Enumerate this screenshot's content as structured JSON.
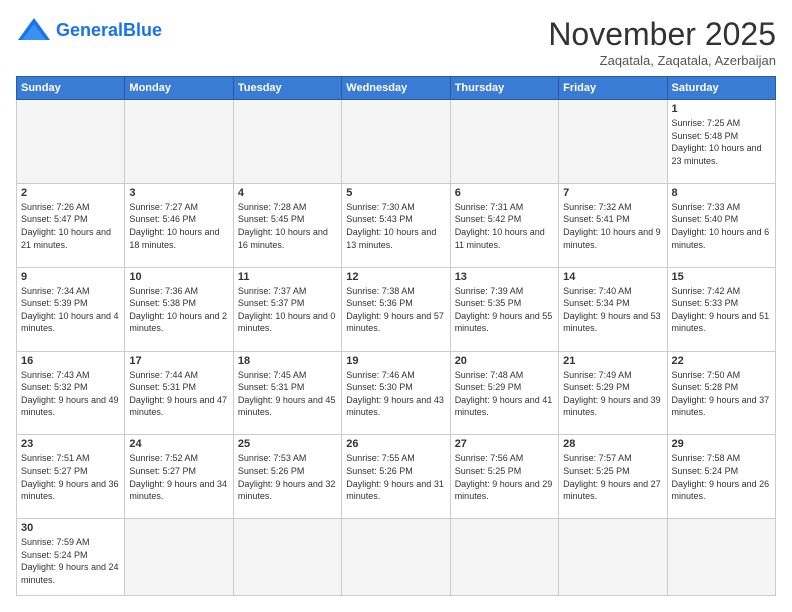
{
  "header": {
    "logo_general": "General",
    "logo_blue": "Blue",
    "month_title": "November 2025",
    "location": "Zaqatala, Zaqatala, Azerbaijan"
  },
  "weekdays": [
    "Sunday",
    "Monday",
    "Tuesday",
    "Wednesday",
    "Thursday",
    "Friday",
    "Saturday"
  ],
  "days": [
    {
      "num": "",
      "sunrise": "",
      "sunset": "",
      "daylight": "",
      "empty": true
    },
    {
      "num": "",
      "sunrise": "",
      "sunset": "",
      "daylight": "",
      "empty": true
    },
    {
      "num": "",
      "sunrise": "",
      "sunset": "",
      "daylight": "",
      "empty": true
    },
    {
      "num": "",
      "sunrise": "",
      "sunset": "",
      "daylight": "",
      "empty": true
    },
    {
      "num": "",
      "sunrise": "",
      "sunset": "",
      "daylight": "",
      "empty": true
    },
    {
      "num": "",
      "sunrise": "",
      "sunset": "",
      "daylight": "",
      "empty": true
    },
    {
      "num": "1",
      "sunrise": "Sunrise: 7:25 AM",
      "sunset": "Sunset: 5:48 PM",
      "daylight": "Daylight: 10 hours and 23 minutes."
    },
    {
      "num": "2",
      "sunrise": "Sunrise: 7:26 AM",
      "sunset": "Sunset: 5:47 PM",
      "daylight": "Daylight: 10 hours and 21 minutes."
    },
    {
      "num": "3",
      "sunrise": "Sunrise: 7:27 AM",
      "sunset": "Sunset: 5:46 PM",
      "daylight": "Daylight: 10 hours and 18 minutes."
    },
    {
      "num": "4",
      "sunrise": "Sunrise: 7:28 AM",
      "sunset": "Sunset: 5:45 PM",
      "daylight": "Daylight: 10 hours and 16 minutes."
    },
    {
      "num": "5",
      "sunrise": "Sunrise: 7:30 AM",
      "sunset": "Sunset: 5:43 PM",
      "daylight": "Daylight: 10 hours and 13 minutes."
    },
    {
      "num": "6",
      "sunrise": "Sunrise: 7:31 AM",
      "sunset": "Sunset: 5:42 PM",
      "daylight": "Daylight: 10 hours and 11 minutes."
    },
    {
      "num": "7",
      "sunrise": "Sunrise: 7:32 AM",
      "sunset": "Sunset: 5:41 PM",
      "daylight": "Daylight: 10 hours and 9 minutes."
    },
    {
      "num": "8",
      "sunrise": "Sunrise: 7:33 AM",
      "sunset": "Sunset: 5:40 PM",
      "daylight": "Daylight: 10 hours and 6 minutes."
    },
    {
      "num": "9",
      "sunrise": "Sunrise: 7:34 AM",
      "sunset": "Sunset: 5:39 PM",
      "daylight": "Daylight: 10 hours and 4 minutes."
    },
    {
      "num": "10",
      "sunrise": "Sunrise: 7:36 AM",
      "sunset": "Sunset: 5:38 PM",
      "daylight": "Daylight: 10 hours and 2 minutes."
    },
    {
      "num": "11",
      "sunrise": "Sunrise: 7:37 AM",
      "sunset": "Sunset: 5:37 PM",
      "daylight": "Daylight: 10 hours and 0 minutes."
    },
    {
      "num": "12",
      "sunrise": "Sunrise: 7:38 AM",
      "sunset": "Sunset: 5:36 PM",
      "daylight": "Daylight: 9 hours and 57 minutes."
    },
    {
      "num": "13",
      "sunrise": "Sunrise: 7:39 AM",
      "sunset": "Sunset: 5:35 PM",
      "daylight": "Daylight: 9 hours and 55 minutes."
    },
    {
      "num": "14",
      "sunrise": "Sunrise: 7:40 AM",
      "sunset": "Sunset: 5:34 PM",
      "daylight": "Daylight: 9 hours and 53 minutes."
    },
    {
      "num": "15",
      "sunrise": "Sunrise: 7:42 AM",
      "sunset": "Sunset: 5:33 PM",
      "daylight": "Daylight: 9 hours and 51 minutes."
    },
    {
      "num": "16",
      "sunrise": "Sunrise: 7:43 AM",
      "sunset": "Sunset: 5:32 PM",
      "daylight": "Daylight: 9 hours and 49 minutes."
    },
    {
      "num": "17",
      "sunrise": "Sunrise: 7:44 AM",
      "sunset": "Sunset: 5:31 PM",
      "daylight": "Daylight: 9 hours and 47 minutes."
    },
    {
      "num": "18",
      "sunrise": "Sunrise: 7:45 AM",
      "sunset": "Sunset: 5:31 PM",
      "daylight": "Daylight: 9 hours and 45 minutes."
    },
    {
      "num": "19",
      "sunrise": "Sunrise: 7:46 AM",
      "sunset": "Sunset: 5:30 PM",
      "daylight": "Daylight: 9 hours and 43 minutes."
    },
    {
      "num": "20",
      "sunrise": "Sunrise: 7:48 AM",
      "sunset": "Sunset: 5:29 PM",
      "daylight": "Daylight: 9 hours and 41 minutes."
    },
    {
      "num": "21",
      "sunrise": "Sunrise: 7:49 AM",
      "sunset": "Sunset: 5:29 PM",
      "daylight": "Daylight: 9 hours and 39 minutes."
    },
    {
      "num": "22",
      "sunrise": "Sunrise: 7:50 AM",
      "sunset": "Sunset: 5:28 PM",
      "daylight": "Daylight: 9 hours and 37 minutes."
    },
    {
      "num": "23",
      "sunrise": "Sunrise: 7:51 AM",
      "sunset": "Sunset: 5:27 PM",
      "daylight": "Daylight: 9 hours and 36 minutes."
    },
    {
      "num": "24",
      "sunrise": "Sunrise: 7:52 AM",
      "sunset": "Sunset: 5:27 PM",
      "daylight": "Daylight: 9 hours and 34 minutes."
    },
    {
      "num": "25",
      "sunrise": "Sunrise: 7:53 AM",
      "sunset": "Sunset: 5:26 PM",
      "daylight": "Daylight: 9 hours and 32 minutes."
    },
    {
      "num": "26",
      "sunrise": "Sunrise: 7:55 AM",
      "sunset": "Sunset: 5:26 PM",
      "daylight": "Daylight: 9 hours and 31 minutes."
    },
    {
      "num": "27",
      "sunrise": "Sunrise: 7:56 AM",
      "sunset": "Sunset: 5:25 PM",
      "daylight": "Daylight: 9 hours and 29 minutes."
    },
    {
      "num": "28",
      "sunrise": "Sunrise: 7:57 AM",
      "sunset": "Sunset: 5:25 PM",
      "daylight": "Daylight: 9 hours and 27 minutes."
    },
    {
      "num": "29",
      "sunrise": "Sunrise: 7:58 AM",
      "sunset": "Sunset: 5:24 PM",
      "daylight": "Daylight: 9 hours and 26 minutes."
    },
    {
      "num": "30",
      "sunrise": "Sunrise: 7:59 AM",
      "sunset": "Sunset: 5:24 PM",
      "daylight": "Daylight: 9 hours and 24 minutes."
    }
  ]
}
